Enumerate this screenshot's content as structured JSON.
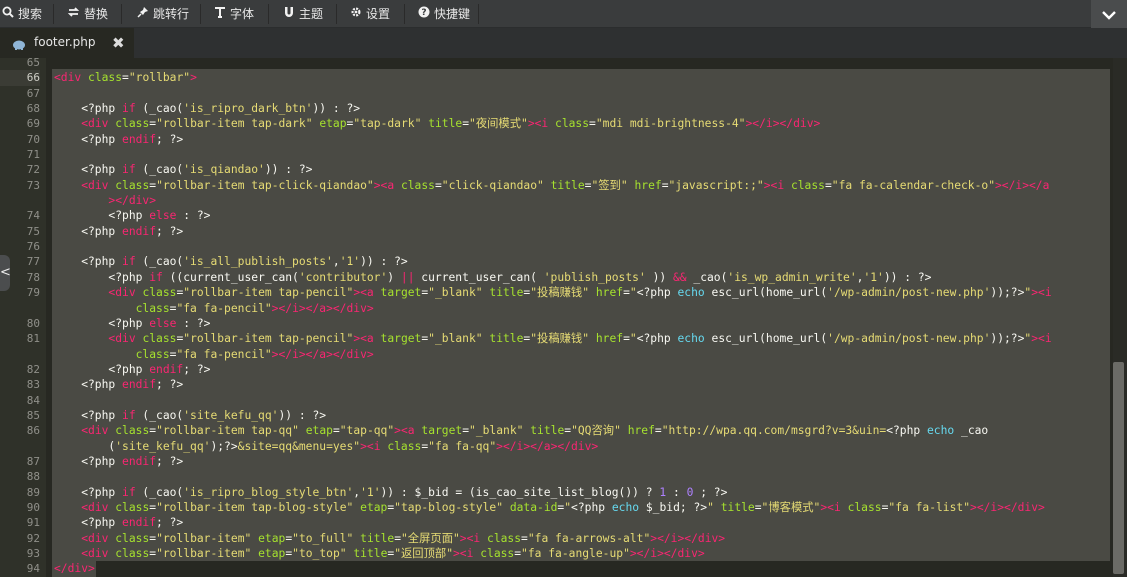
{
  "toolbar": {
    "search": "搜索",
    "replace": "替换",
    "goto_line": "跳转行",
    "font": "字体",
    "theme": "主题",
    "settings": "设置",
    "shortcuts": "快捷键"
  },
  "tab": {
    "filename": "footer.php"
  },
  "icons": {
    "search": "search-icon",
    "replace": "replace-icon",
    "goto": "pin-icon",
    "font": "font-icon",
    "theme": "magnet-icon",
    "settings": "gear-icon",
    "shortcuts": "help-icon",
    "collapse": "chevron-down-icon",
    "file": "php-elephant-icon",
    "close": "close-icon",
    "fold": "chevron-left-icon"
  },
  "colors": {
    "background": "#272822",
    "selection": "#4a4a44",
    "tag": "#f92672",
    "attribute": "#a6e22e",
    "string": "#e6db74",
    "function": "#66d9ef",
    "number": "#ae81ff"
  },
  "line_numbers": [
    "65",
    "66",
    "67",
    "68",
    "69",
    "70",
    "71",
    "72",
    "73",
    "",
    "74",
    "75",
    "76",
    "77",
    "78",
    "79",
    "",
    "80",
    "81",
    "",
    "82",
    "83",
    "84",
    "85",
    "86",
    "",
    "87",
    "88",
    "89",
    "90",
    "91",
    "92",
    "93",
    "94"
  ],
  "active_line": "66",
  "code": {
    "l65": "",
    "l66": "<div class=\"rollbar\">",
    "l67": "",
    "l68": "    <?php if (_cao('is_ripro_dark_btn')) : ?>",
    "l69": "    <div class=\"rollbar-item tap-dark\" etap=\"tap-dark\" title=\"夜间模式\"><i class=\"mdi mdi-brightness-4\"></i></div>",
    "l70": "    <?php endif; ?>",
    "l71": "",
    "l72": "    <?php if (_cao('is_qiandao')) : ?>",
    "l73": "    <div class=\"rollbar-item tap-click-qiandao\"><a class=\"click-qiandao\" title=\"签到\" href=\"javascript:;\"><i class=\"fa fa-calendar-check-o\"></i></a",
    "l73b": "        ></div>",
    "l74": "        <?php else : ?>",
    "l75": "    <?php endif; ?>",
    "l76": "",
    "l77": "    <?php if (_cao('is_all_publish_posts','1')) : ?>",
    "l78": "        <?php if ((current_user_can('contributor') || current_user_can( 'publish_posts' )) && _cao('is_wp_admin_write','1')) : ?>",
    "l79": "        <div class=\"rollbar-item tap-pencil\"><a target=\"_blank\" title=\"投稿赚钱\" href=\"<?php echo esc_url(home_url('/wp-admin/post-new.php'));?>\"><i",
    "l79b": "            class=\"fa fa-pencil\"></i></a></div>",
    "l80": "        <?php else : ?>",
    "l81": "        <div class=\"rollbar-item tap-pencil\"><a target=\"_blank\" title=\"投稿赚钱\" href=\"<?php echo esc_url(home_url('/wp-admin/post-new.php'));?>\"><i",
    "l81b": "            class=\"fa fa-pencil\"></i></a></div>",
    "l82": "        <?php endif; ?>",
    "l83": "    <?php endif; ?>",
    "l84": "",
    "l85": "    <?php if (_cao('site_kefu_qq')) : ?>",
    "l86": "    <div class=\"rollbar-item tap-qq\" etap=\"tap-qq\"><a target=\"_blank\" title=\"QQ咨询\" href=\"http://wpa.qq.com/msgrd?v=3&uin=<?php echo _cao",
    "l86b": "        ('site_kefu_qq');?>&site=qq&menu=yes\"><i class=\"fa fa-qq\"></i></a></div>",
    "l87": "    <?php endif; ?>",
    "l88": "",
    "l89": "    <?php if (_cao('is_ripro_blog_style_btn','1')) : $_bid = (is_cao_site_list_blog()) ? 1 : 0 ; ?>",
    "l90": "    <div class=\"rollbar-item tap-blog-style\" etap=\"tap-blog-style\" data-id=\"<?php echo $_bid; ?>\" title=\"博客模式\"><i class=\"fa fa-list\"></i></div>",
    "l91": "    <?php endif; ?>",
    "l92": "    <div class=\"rollbar-item\" etap=\"to_full\" title=\"全屏页面\"><i class=\"fa fa-arrows-alt\"></i></div>",
    "l93": "    <div class=\"rollbar-item\" etap=\"to_top\" title=\"返回顶部\"><i class=\"fa fa-angle-up\"></i></div>",
    "l94": "</div>"
  }
}
